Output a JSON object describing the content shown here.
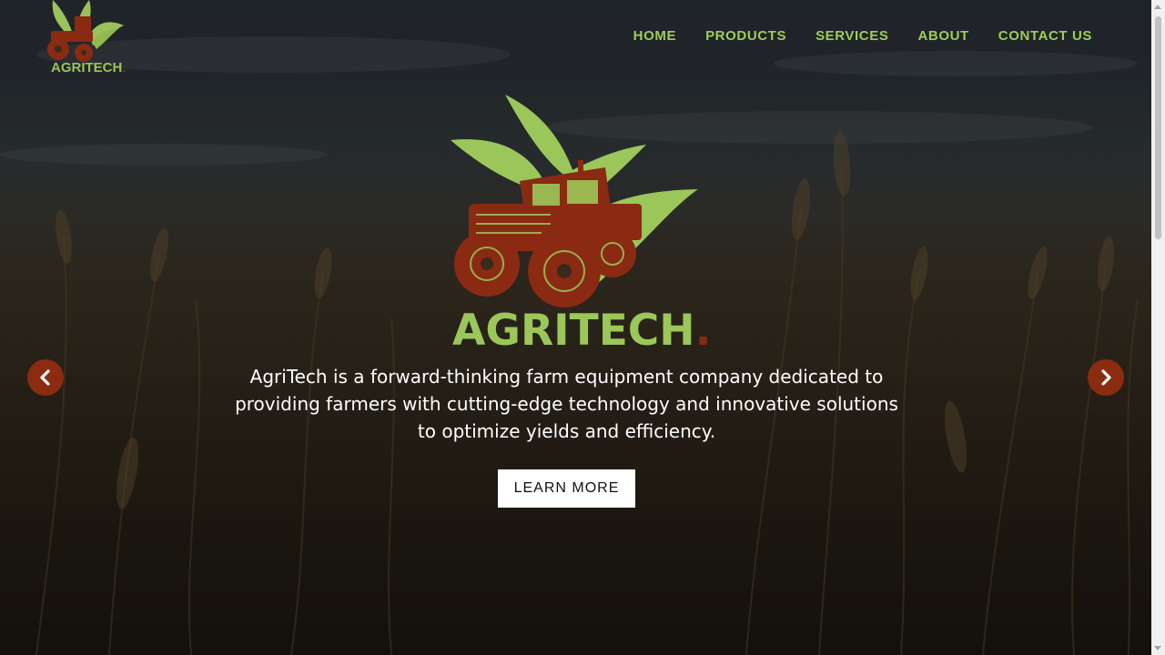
{
  "site": {
    "logo_text": "AGRITECH",
    "logo_dot": "."
  },
  "nav": {
    "items": [
      {
        "label": "HOME"
      },
      {
        "label": "PRODUCTS"
      },
      {
        "label": "SERVICES"
      },
      {
        "label": "ABOUT"
      },
      {
        "label": "CONTACT US"
      }
    ]
  },
  "hero": {
    "logo_text": "AGRITECH",
    "logo_dot": ".",
    "description": "AgriTech is a forward-thinking farm equipment company dedicated to providing farmers with cutting-edge technology and innovative solutions to optimize yields and efficiency.",
    "button_label": "LEARN MORE",
    "prev_icon": "chevron-left-icon",
    "next_icon": "chevron-right-icon"
  },
  "colors": {
    "brand_green": "#9fcc57",
    "brand_red": "#8b2b10",
    "button_bg": "#ffffff"
  }
}
